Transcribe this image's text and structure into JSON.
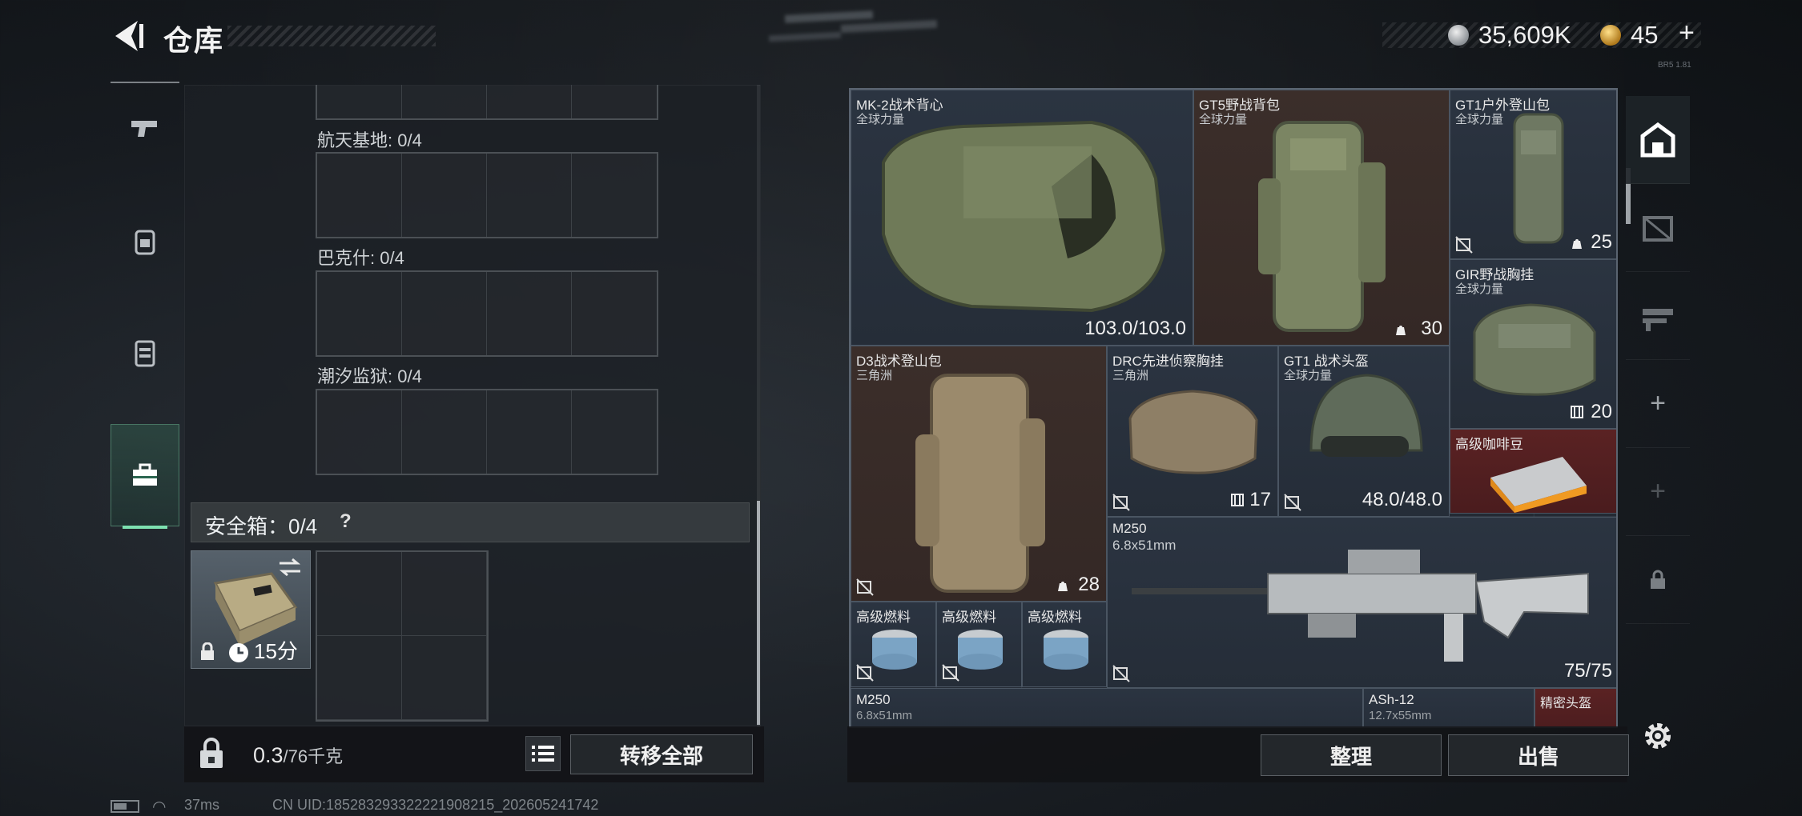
{
  "header": {
    "title": "仓库",
    "currency_silver": "35,609K",
    "currency_gold": "45",
    "plus": "+",
    "tiny_code": "BR5 1.81"
  },
  "left_tabs": [
    {
      "name": "weapons",
      "icon": "pistol-icon"
    },
    {
      "name": "armor",
      "icon": "backpack-icon"
    },
    {
      "name": "equipment",
      "icon": "vest-icon"
    },
    {
      "name": "toolbox",
      "icon": "briefcase-icon",
      "active": true
    }
  ],
  "regions": [
    {
      "label": "航天基地: 0/4"
    },
    {
      "label": "巴克什: 0/4"
    },
    {
      "label": "潮汐监狱: 0/4"
    }
  ],
  "safebox": {
    "label": "安全箱：0/4",
    "help": "?",
    "timer": "15分"
  },
  "weight": {
    "current": "0.3",
    "max": "/76千克"
  },
  "buttons": {
    "transfer_all": "转移全部",
    "sort": "整理",
    "sell": "出售"
  },
  "stash_items": [
    {
      "name": "MK-2战术背心",
      "sub": "全球力量",
      "value": "103.0/103.0"
    },
    {
      "name": "GT5野战背包",
      "sub": "全球力量",
      "value": "30"
    },
    {
      "name": "GT1户外登山包",
      "sub": "全球力量",
      "value": "25"
    },
    {
      "name": "GIR野战胸挂",
      "sub": "全球力量",
      "value": "20"
    },
    {
      "name": "D3战术登山包",
      "sub": "三角洲",
      "value": "28"
    },
    {
      "name": "DRC先进侦察胸挂",
      "sub": "三角洲",
      "value": "17"
    },
    {
      "name": "GT1 战术头盔",
      "sub": "全球力量",
      "value": "48.0/48.0"
    },
    {
      "name": "高级咖啡豆",
      "sub": "",
      "value": ""
    },
    {
      "name": "M250",
      "sub": "6.8x51mm",
      "value": "75/75"
    },
    {
      "name": "高级燃料",
      "sub": "",
      "value": ""
    },
    {
      "name": "高级燃料",
      "sub": "",
      "value": ""
    },
    {
      "name": "高级燃料",
      "sub": "",
      "value": ""
    },
    {
      "name": "M250",
      "sub": "6.8x51mm",
      "value": ""
    },
    {
      "name": "ASh-12",
      "sub": "12.7x55mm",
      "value": ""
    },
    {
      "name": "精密头盔",
      "sub": "",
      "value": ""
    }
  ],
  "status": {
    "ping": "37ms",
    "uid": "CN UID:18528329332222190821​5_202605241742"
  },
  "colors": {
    "accent_green": "#7de0b0",
    "item_gray": "#2b3441",
    "item_brown": "#3b2e2a",
    "item_red": "#5a2223"
  }
}
